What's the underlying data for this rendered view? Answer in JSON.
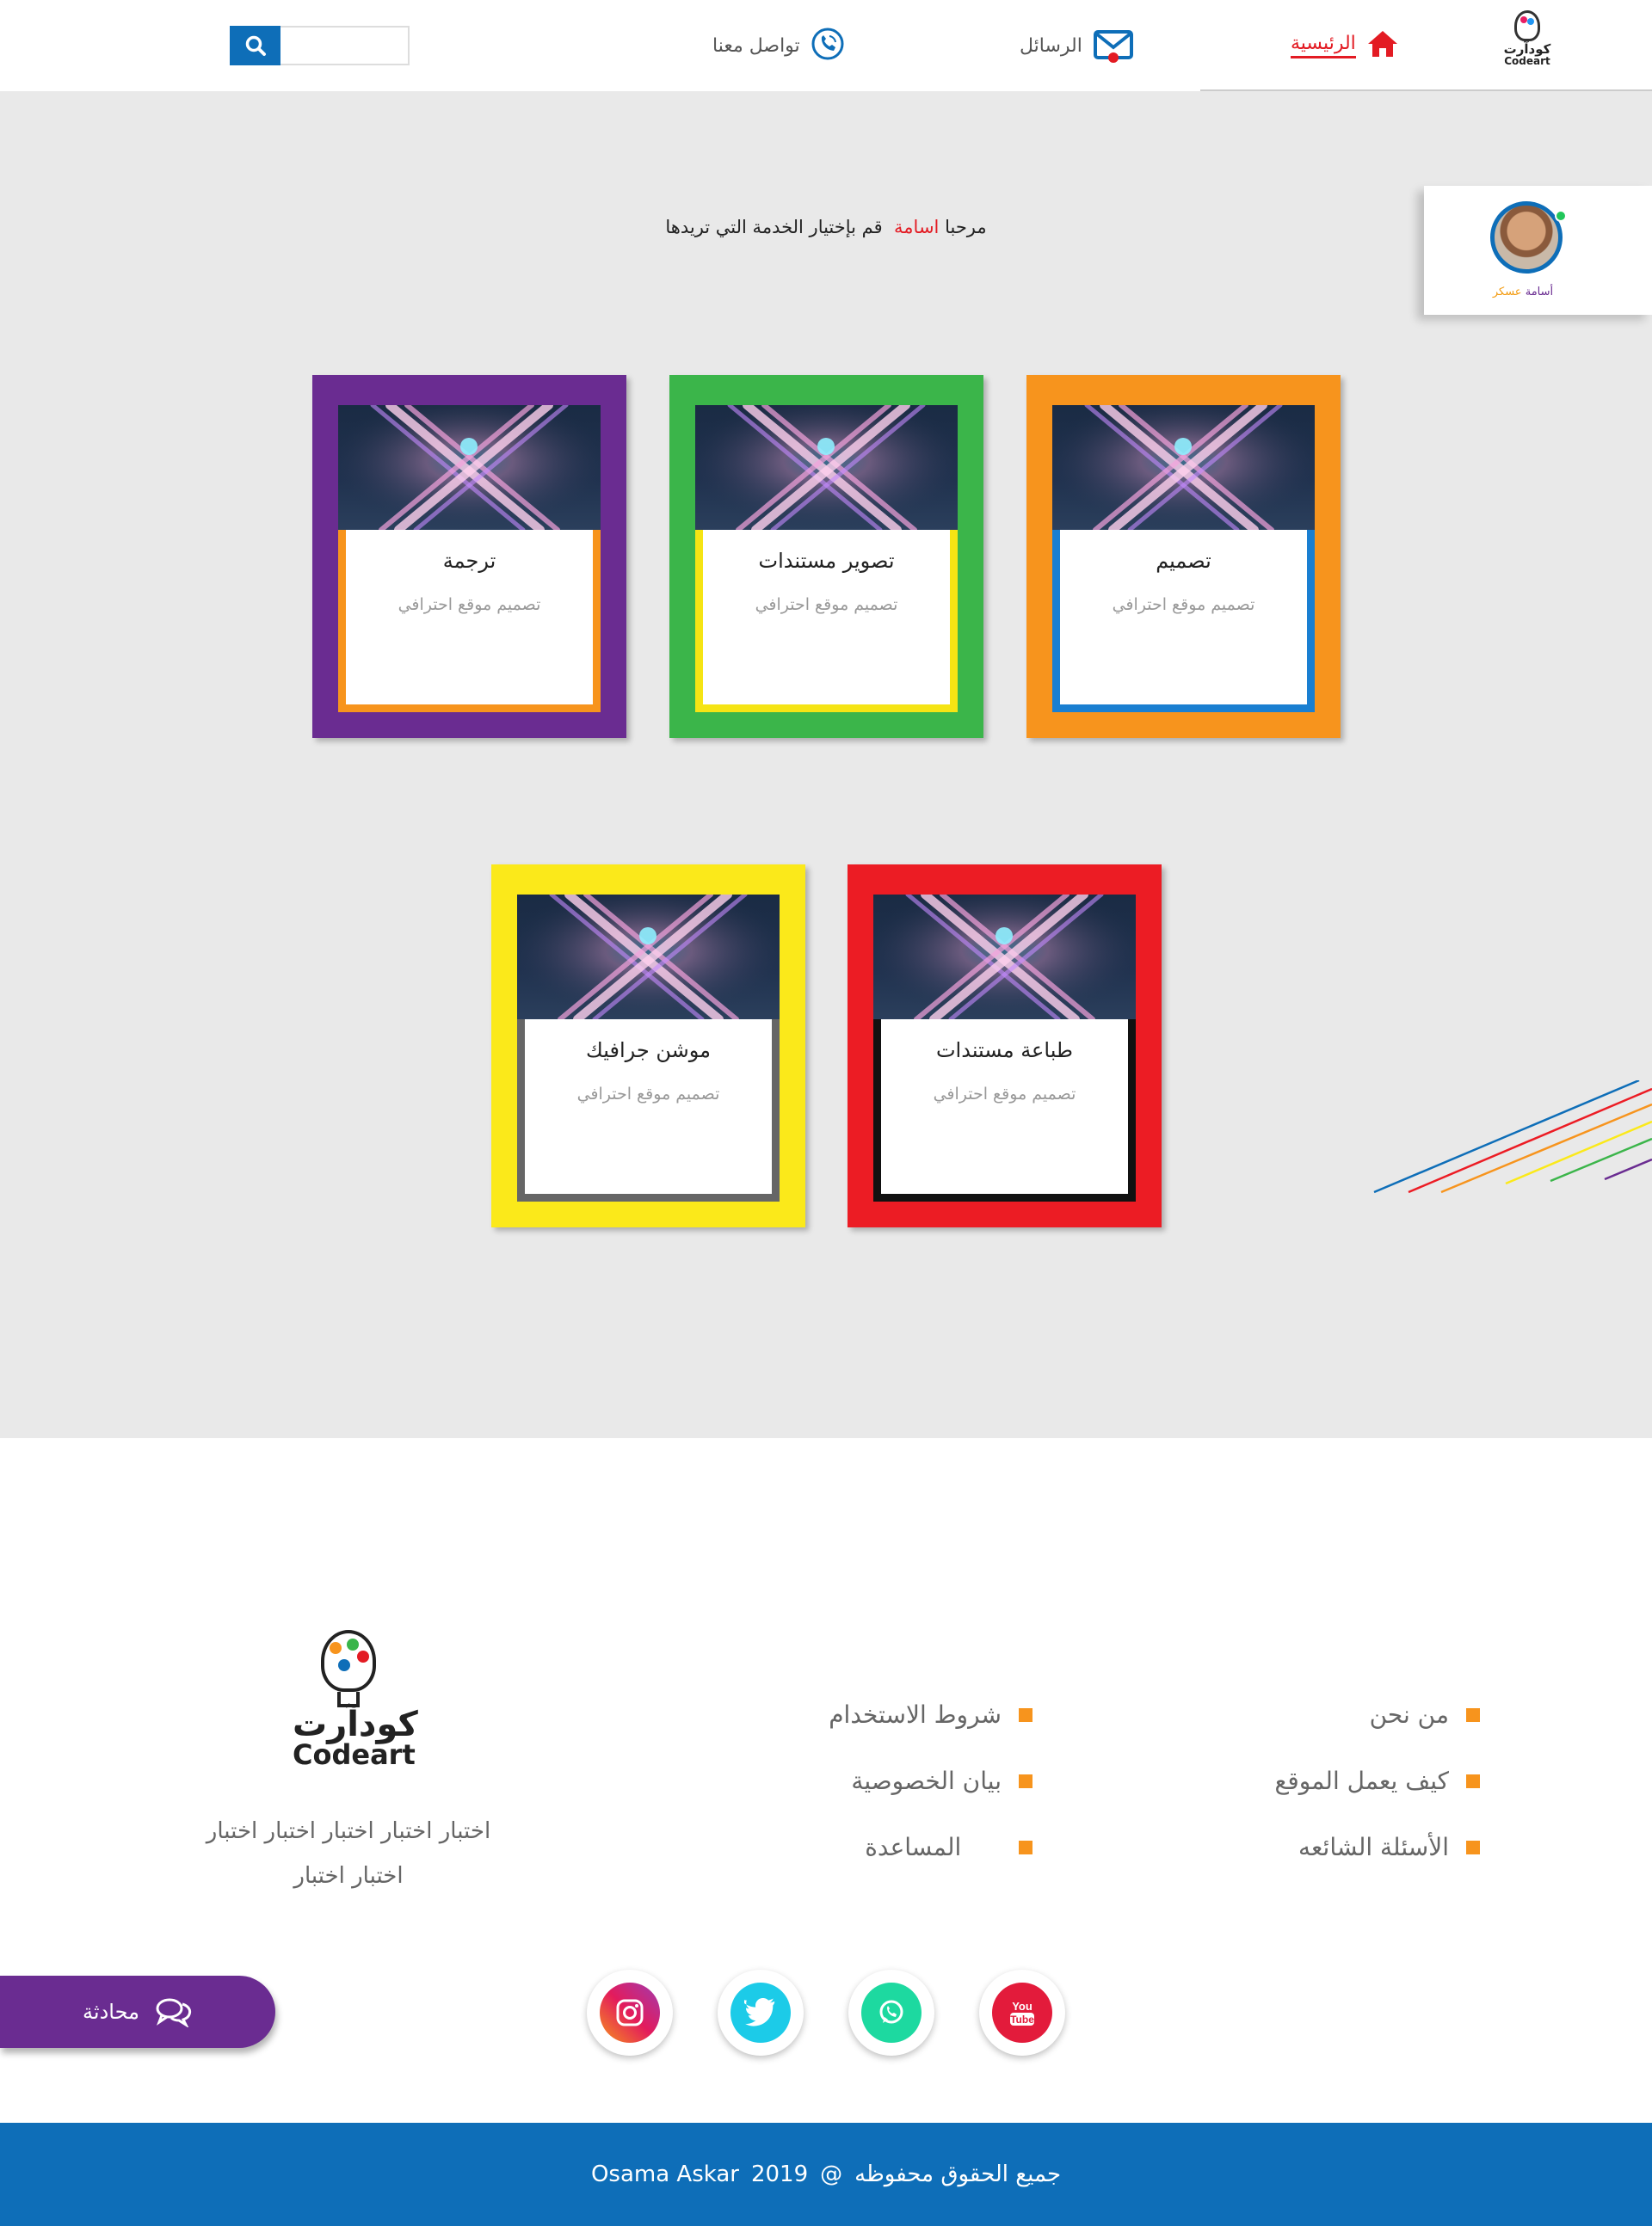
{
  "header": {
    "logo": {
      "arabic": "كودآرت",
      "english": "Codeart"
    },
    "nav": [
      {
        "label": "الرئيسية",
        "icon": "home-icon",
        "active": true
      },
      {
        "label": "الرسائل",
        "icon": "envelope-icon"
      },
      {
        "label": "تواصل معنا",
        "icon": "phone-icon"
      }
    ],
    "search": {
      "placeholder": "",
      "value": ""
    }
  },
  "user": {
    "first_name": "أسامة",
    "last_name": "عسكر",
    "online": true
  },
  "welcome": {
    "prefix": "مرحبا",
    "name": "اسامة",
    "suffix": "قم بإختيار الخدمة التي تريدها"
  },
  "services": [
    {
      "title": "تصميم",
      "description": "تصميم موقع احترافي",
      "outer_color": "#f7941d",
      "inner_color": "#1a7fd1"
    },
    {
      "title": "تصوير مستندات",
      "description": "تصميم موقع احترافي",
      "outer_color": "#3bb54a",
      "inner_color": "#f5e414"
    },
    {
      "title": "ترجمة",
      "description": "تصميم موقع احترافي",
      "outer_color": "#6a2c91",
      "inner_color": "#f7941d"
    },
    {
      "title": "طباعة مستندات",
      "description": "تصميم موقع احترافي",
      "outer_color": "#ec1c24",
      "inner_color": "#111111"
    },
    {
      "title": "موشن جرافيك",
      "description": "تصميم موقع احترافي",
      "outer_color": "#fbe91a",
      "inner_color": "#666666"
    }
  ],
  "footer": {
    "links_right": [
      "من نحن",
      "كيف يعمل الموقع",
      "الأسئلة الشائعه"
    ],
    "links_mid": [
      "شروط الاستخدام",
      "بيان الخصوصية",
      "المساعدة"
    ],
    "logo": {
      "arabic": "كودآرت",
      "english": "Codeart"
    },
    "about_line1": "اختبار اختبار اختبار اختبار اختبار",
    "about_line2": "اختبار اختبار",
    "social": [
      {
        "name": "youtube-icon",
        "color": "#e31b3b"
      },
      {
        "name": "whatsapp-icon",
        "color": "#1dd9a0"
      },
      {
        "name": "twitter-icon",
        "color": "#1ccbe8"
      },
      {
        "name": "instagram-icon",
        "color": "#a13bb0"
      }
    ]
  },
  "chat": {
    "label": "محادثة"
  },
  "copyright": {
    "text": "جميع الحقوق محفوظه",
    "symbol": "@",
    "year": "2019",
    "owner": "Osama Askar"
  },
  "colors": {
    "primary": "#0e6eb8",
    "accent_red": "#e31b23",
    "chat_purple": "#6a2c91",
    "bullet_orange": "#f7941d"
  }
}
